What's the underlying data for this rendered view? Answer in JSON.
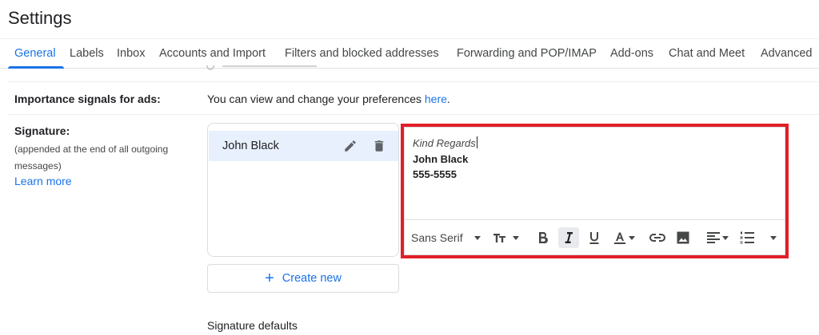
{
  "page": {
    "title": "Settings"
  },
  "tabs": [
    {
      "label": "General",
      "active": true
    },
    {
      "label": "Labels"
    },
    {
      "label": "Inbox"
    },
    {
      "label": "Accounts and Import"
    },
    {
      "label": "Filters and blocked addresses"
    },
    {
      "label": "Forwarding and POP/IMAP"
    },
    {
      "label": "Add-ons"
    },
    {
      "label": "Chat and Meet"
    },
    {
      "label": "Advanced"
    }
  ],
  "importance": {
    "label": "Importance signals for ads:",
    "text": "You can view and change your preferences ",
    "link": "here",
    "after": "."
  },
  "signature": {
    "label": "Signature:",
    "note": "(appended at the end of all outgoing messages)",
    "learn_more": "Learn more",
    "items": [
      {
        "name": "John Black"
      }
    ],
    "editor": {
      "line1": "Kind Regards",
      "line2": "John Black",
      "line3": "555-5555"
    },
    "toolbar": {
      "font": "Sans Serif",
      "icons": [
        "text-size-icon",
        "bold-icon",
        "italic-icon",
        "underline-icon",
        "text-color-icon",
        "link-icon",
        "image-icon",
        "align-icon",
        "numbered-list-icon",
        "more-formatting-icon"
      ]
    },
    "create_new": "Create new",
    "defaults_heading": "Signature defaults"
  },
  "colors": {
    "accent": "#1a73e8",
    "highlight_border": "#e21f26",
    "selected_item_bg": "#e8f0fe"
  }
}
